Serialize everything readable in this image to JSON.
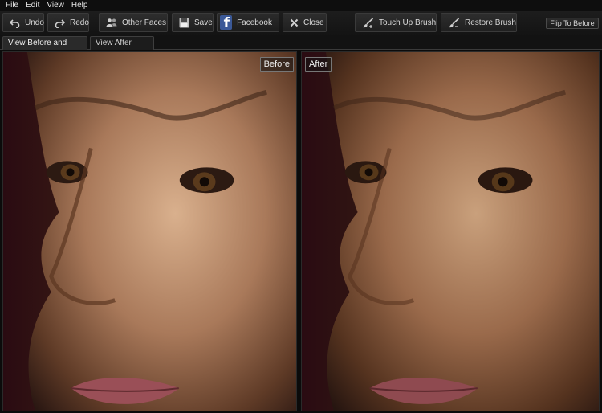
{
  "menu": [
    "File",
    "Edit",
    "View",
    "Help"
  ],
  "toolbar": {
    "undo": "Undo",
    "redo": "Redo",
    "other_faces": "Other Faces",
    "save": "Save",
    "facebook": "Facebook",
    "close": "Close",
    "touch_up_brush": "Touch Up Brush",
    "restore_brush": "Restore Brush",
    "flip_to_before": "Flip To Before"
  },
  "tabs": {
    "before_and_after": "View Before and After",
    "after_only": "View After Only"
  },
  "panels": {
    "before_label": "Before",
    "after_label": "After"
  },
  "colors": {
    "facebook_blue": "#3b5998",
    "background": "#0b0b0b"
  }
}
